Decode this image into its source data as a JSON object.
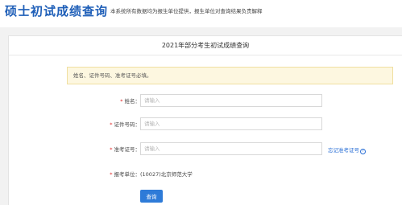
{
  "header": {
    "title": "硕士初试成绩查询",
    "description": "本系统所有数据均为报生单位提供，报生单位对查询结果负责解释"
  },
  "card": {
    "title": "2021年部分考生初试成绩查询",
    "notice": "姓名、证件号码、准考证号必填。"
  },
  "form": {
    "required_mark": "*",
    "name": {
      "label": "姓名：",
      "placeholder": "请输入",
      "value": ""
    },
    "id_number": {
      "label": "证件号码：",
      "placeholder": "请输入",
      "value": ""
    },
    "exam_number": {
      "label": "准考证号：",
      "placeholder": "请输入",
      "value": "",
      "forgot_link": "忘记准考证号",
      "help_icon_glyph": "?"
    },
    "unit": {
      "label": "报考单位：",
      "value": "(10027)北京师范大学"
    },
    "submit_label": "查询"
  },
  "colors": {
    "brand": "#1f5fb8",
    "button": "#2e7bd8",
    "required": "#e02020",
    "notice_bg": "#fdf7e0",
    "link": "#2a6fd6"
  }
}
